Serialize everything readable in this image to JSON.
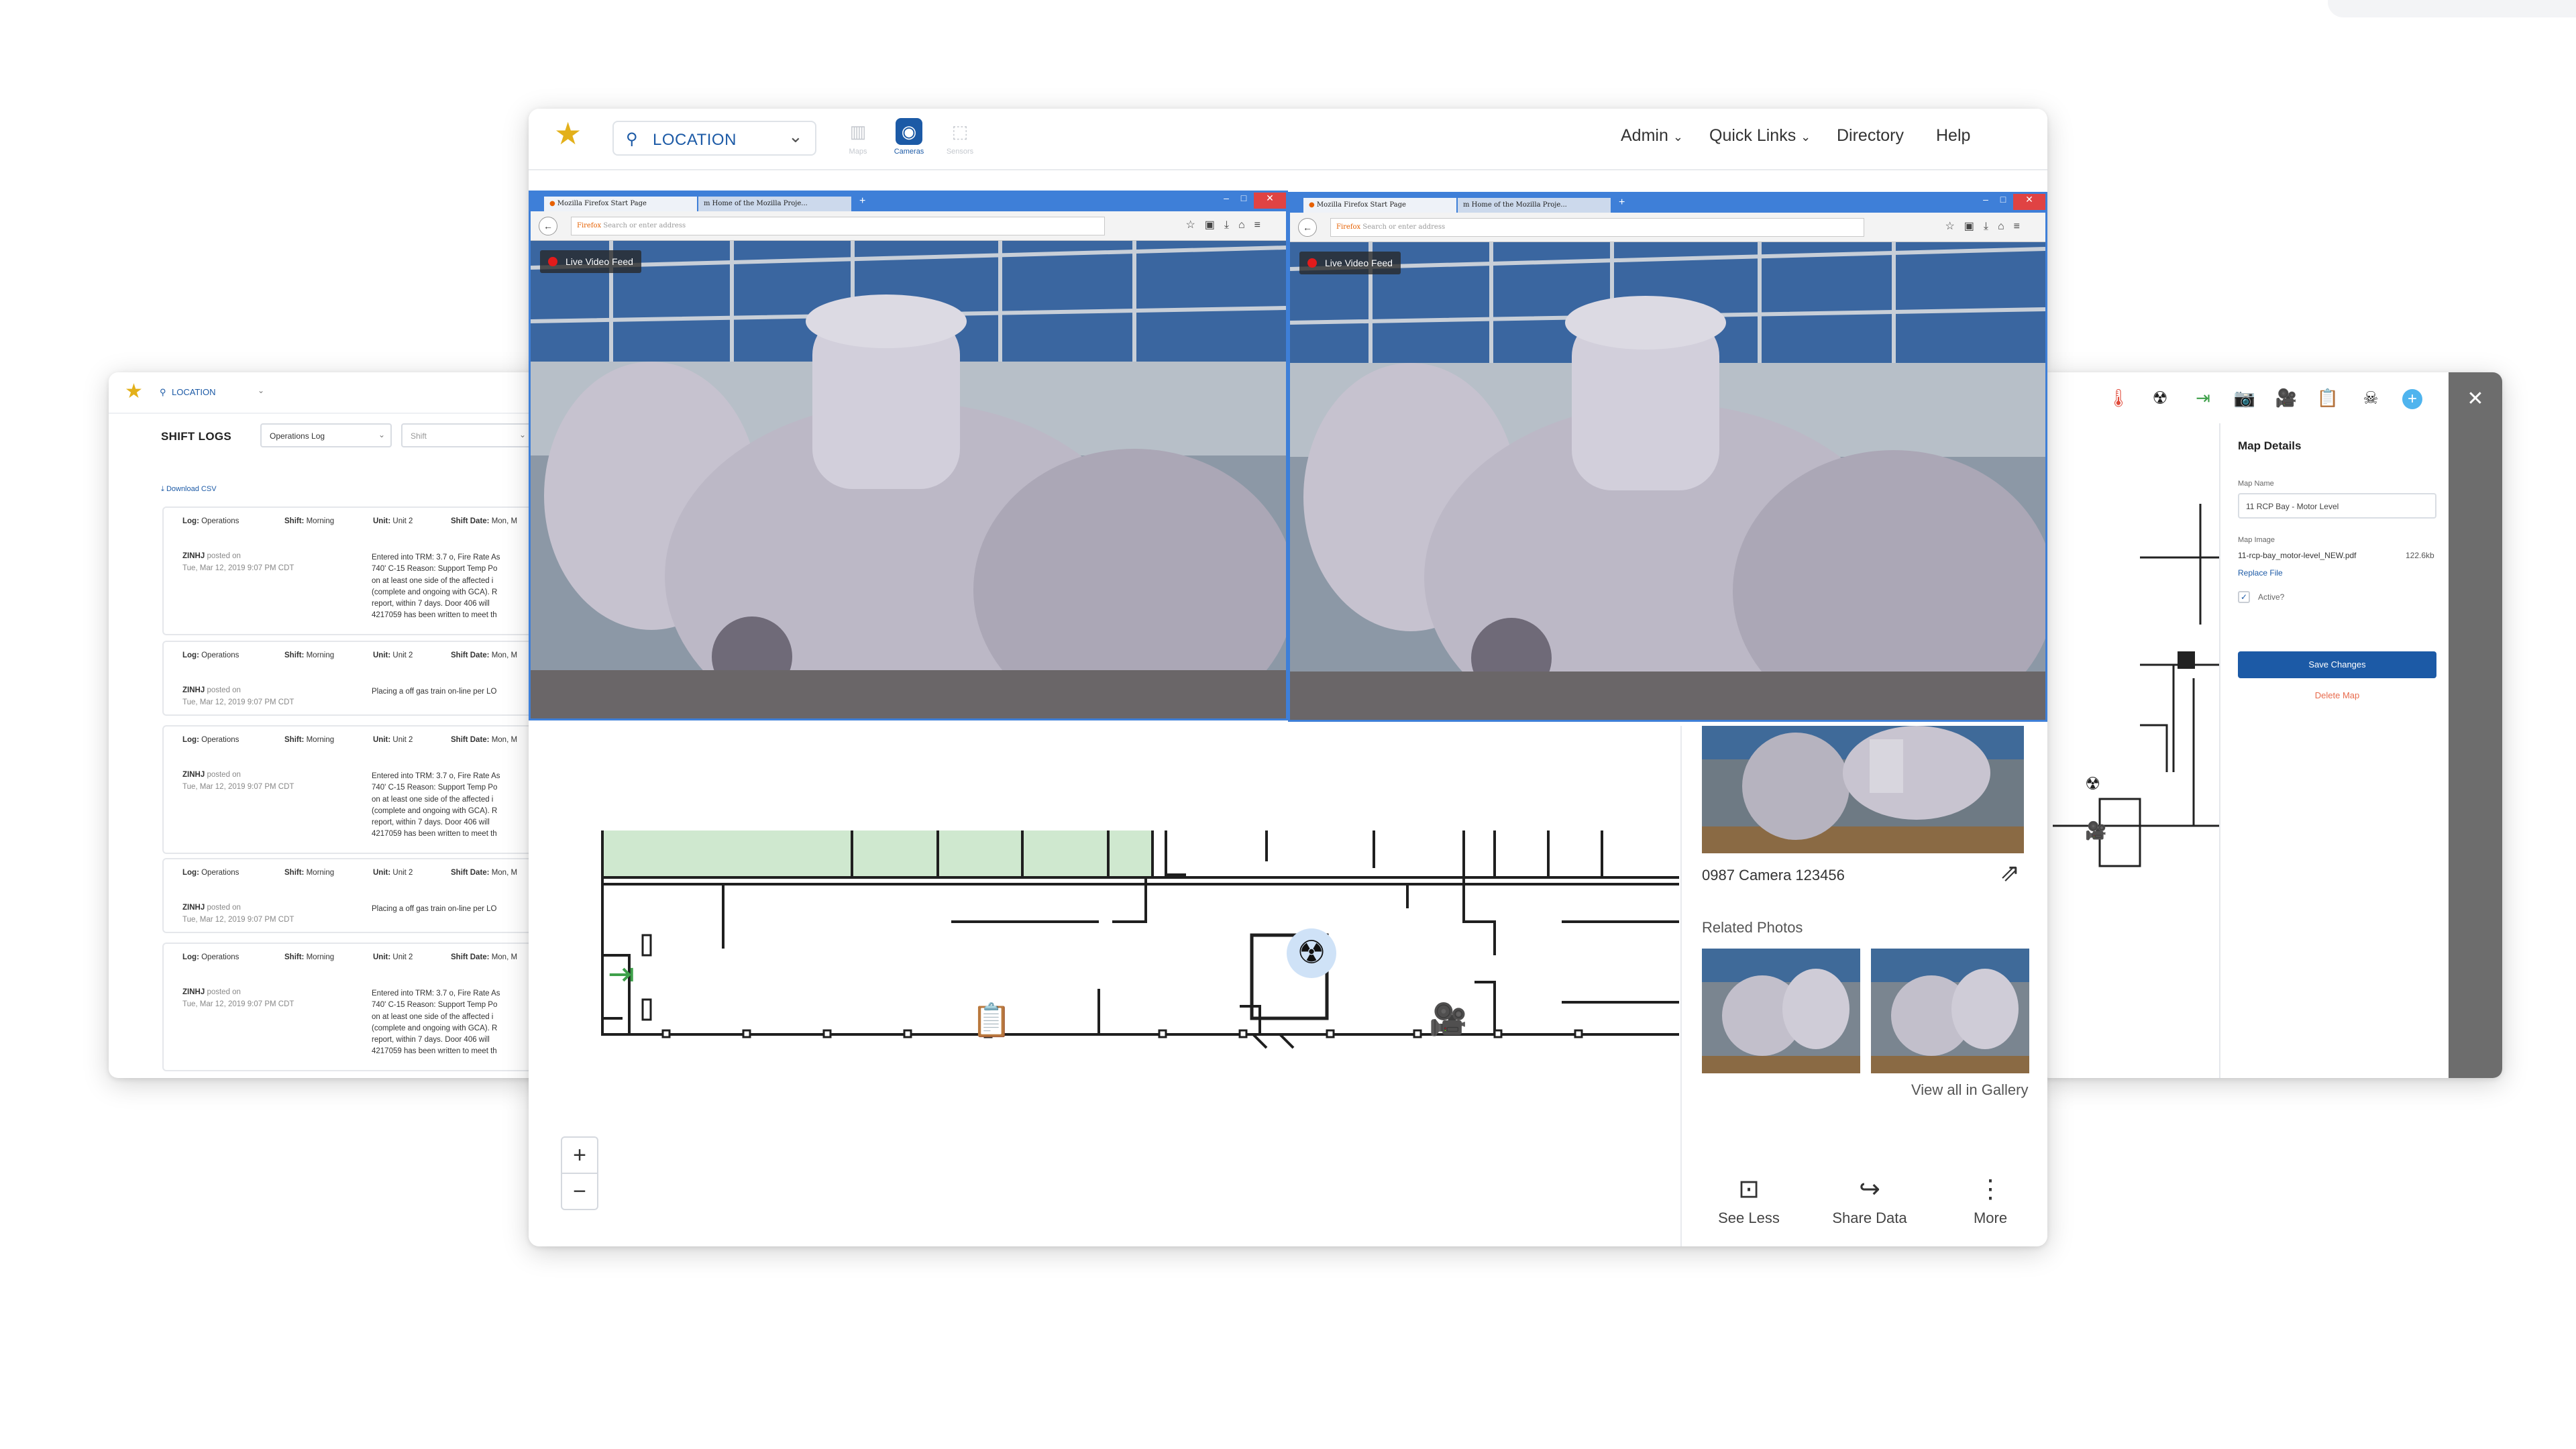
{
  "main_header": {
    "location_label": "LOCATION",
    "view_tabs": [
      {
        "label": "Maps"
      },
      {
        "label": "Cameras"
      },
      {
        "label": "Sensors"
      }
    ],
    "nav": {
      "admin": "Admin",
      "quick_links": "Quick Links",
      "directory": "Directory",
      "help": "Help"
    }
  },
  "browser_windows": [
    {
      "tab_active": "Mozilla Firefox Start Page",
      "tab_inactive": "Home of the Mozilla Proje...",
      "url_prefix": "Firefox",
      "url_placeholder": "Search or enter address",
      "badge": "Live Video Feed"
    },
    {
      "tab_active": "Mozilla Firefox Start Page",
      "tab_inactive": "Home of the Mozilla Proje...",
      "url_prefix": "Firefox",
      "url_placeholder": "Search or enter address",
      "badge": "Live Video Feed"
    }
  ],
  "side_panel": {
    "camera_name": "0987 Camera 123456",
    "related_title": "Related Photos",
    "gallery_link": "View all in Gallery",
    "actions": {
      "see_less": "See Less",
      "share_data": "Share Data",
      "more": "More"
    }
  },
  "zoom": {
    "in": "+",
    "out": "−"
  },
  "shift_logs": {
    "location": "LOCATION",
    "title": "SHIFT LOGS",
    "log_select": "Operations Log",
    "shift_select": "Shift",
    "download": "Download CSV",
    "entries": [
      {
        "log_label": "Log:",
        "log": "Operations",
        "shift_label": "Shift:",
        "shift": "Morning",
        "unit_label": "Unit:",
        "unit": "Unit 2",
        "date_label": "Shift Date:",
        "date": "Mon, M",
        "user": "ZINHJ",
        "posted": "posted on",
        "ts": "Tue, Mar 12, 2019 9:07 PM CDT",
        "body": "Entered into TRM: 3.7 o, Fire Rate As\n740' C-15 Reason: Support Temp Po\non at least one side of the affected i\n(complete and ongoing with GCA). R\nreport, within 7 days. Door 406 will\n4217059 has been written to meet th"
      },
      {
        "log_label": "Log:",
        "log": "Operations",
        "shift_label": "Shift:",
        "shift": "Morning",
        "unit_label": "Unit:",
        "unit": "Unit 2",
        "date_label": "Shift Date:",
        "date": "Mon, M",
        "user": "ZINHJ",
        "posted": "posted on",
        "ts": "Tue, Mar 12, 2019 9:07 PM CDT",
        "body": "Placing a off gas train on-line per LO"
      },
      {
        "log_label": "Log:",
        "log": "Operations",
        "shift_label": "Shift:",
        "shift": "Morning",
        "unit_label": "Unit:",
        "unit": "Unit 2",
        "date_label": "Shift Date:",
        "date": "Mon, M",
        "user": "ZINHJ",
        "posted": "posted on",
        "ts": "Tue, Mar 12, 2019 9:07 PM CDT",
        "body": "Entered into TRM: 3.7 o, Fire Rate As\n740' C-15 Reason: Support Temp Po\non at least one side of the affected i\n(complete and ongoing with GCA). R\nreport, within 7 days. Door 406 will\n4217059 has been written to meet th"
      },
      {
        "log_label": "Log:",
        "log": "Operations",
        "shift_label": "Shift:",
        "shift": "Morning",
        "unit_label": "Unit:",
        "unit": "Unit 2",
        "date_label": "Shift Date:",
        "date": "Mon, M",
        "user": "ZINHJ",
        "posted": "posted on",
        "ts": "Tue, Mar 12, 2019 9:07 PM CDT",
        "body": "Placing a off gas train on-line per LO"
      },
      {
        "log_label": "Log:",
        "log": "Operations",
        "shift_label": "Shift:",
        "shift": "Morning",
        "unit_label": "Unit:",
        "unit": "Unit 2",
        "date_label": "Shift Date:",
        "date": "Mon, M",
        "user": "ZINHJ",
        "posted": "posted on",
        "ts": "Tue, Mar 12, 2019 9:07 PM CDT",
        "body": "Entered into TRM: 3.7 o, Fire Rate As\n740' C-15 Reason: Support Temp Po\non at least one side of the affected i\n(complete and ongoing with GCA). R\nreport, within 7 days. Door 406 will\n4217059 has been written to meet th"
      }
    ]
  },
  "map_details": {
    "title": "Map Details",
    "map_name_label": "Map Name",
    "map_name_value": "11 RCP Bay - Motor Level",
    "map_image_label": "Map Image",
    "file_name": "11-rcp-bay_motor-level_NEW.pdf",
    "file_size": "122.6kb",
    "replace_file": "Replace File",
    "active_label": "Active?",
    "save_button": "Save Changes",
    "delete_link": "Delete Map"
  },
  "colors": {
    "brand_blue": "#1c5aa6",
    "star_gold": "#e3b01a",
    "camera_orange": "#ee7d22",
    "exit_green": "#3ea04a",
    "delete_red": "#e86b4d",
    "firefox_blue": "#3e7fd8"
  },
  "icons": [
    "star-icon",
    "location-pin-icon",
    "chevron-down-icon",
    "maps-icon",
    "camera-icon",
    "sensors-icon",
    "thermometer-icon",
    "radiation-icon",
    "exit-icon",
    "photo-camera-icon",
    "video-camera-icon",
    "clipboard-icon",
    "skull-icon",
    "add-icon",
    "close-icon",
    "external-link-icon",
    "see-less-icon",
    "share-icon",
    "more-icon",
    "download-icon"
  ]
}
